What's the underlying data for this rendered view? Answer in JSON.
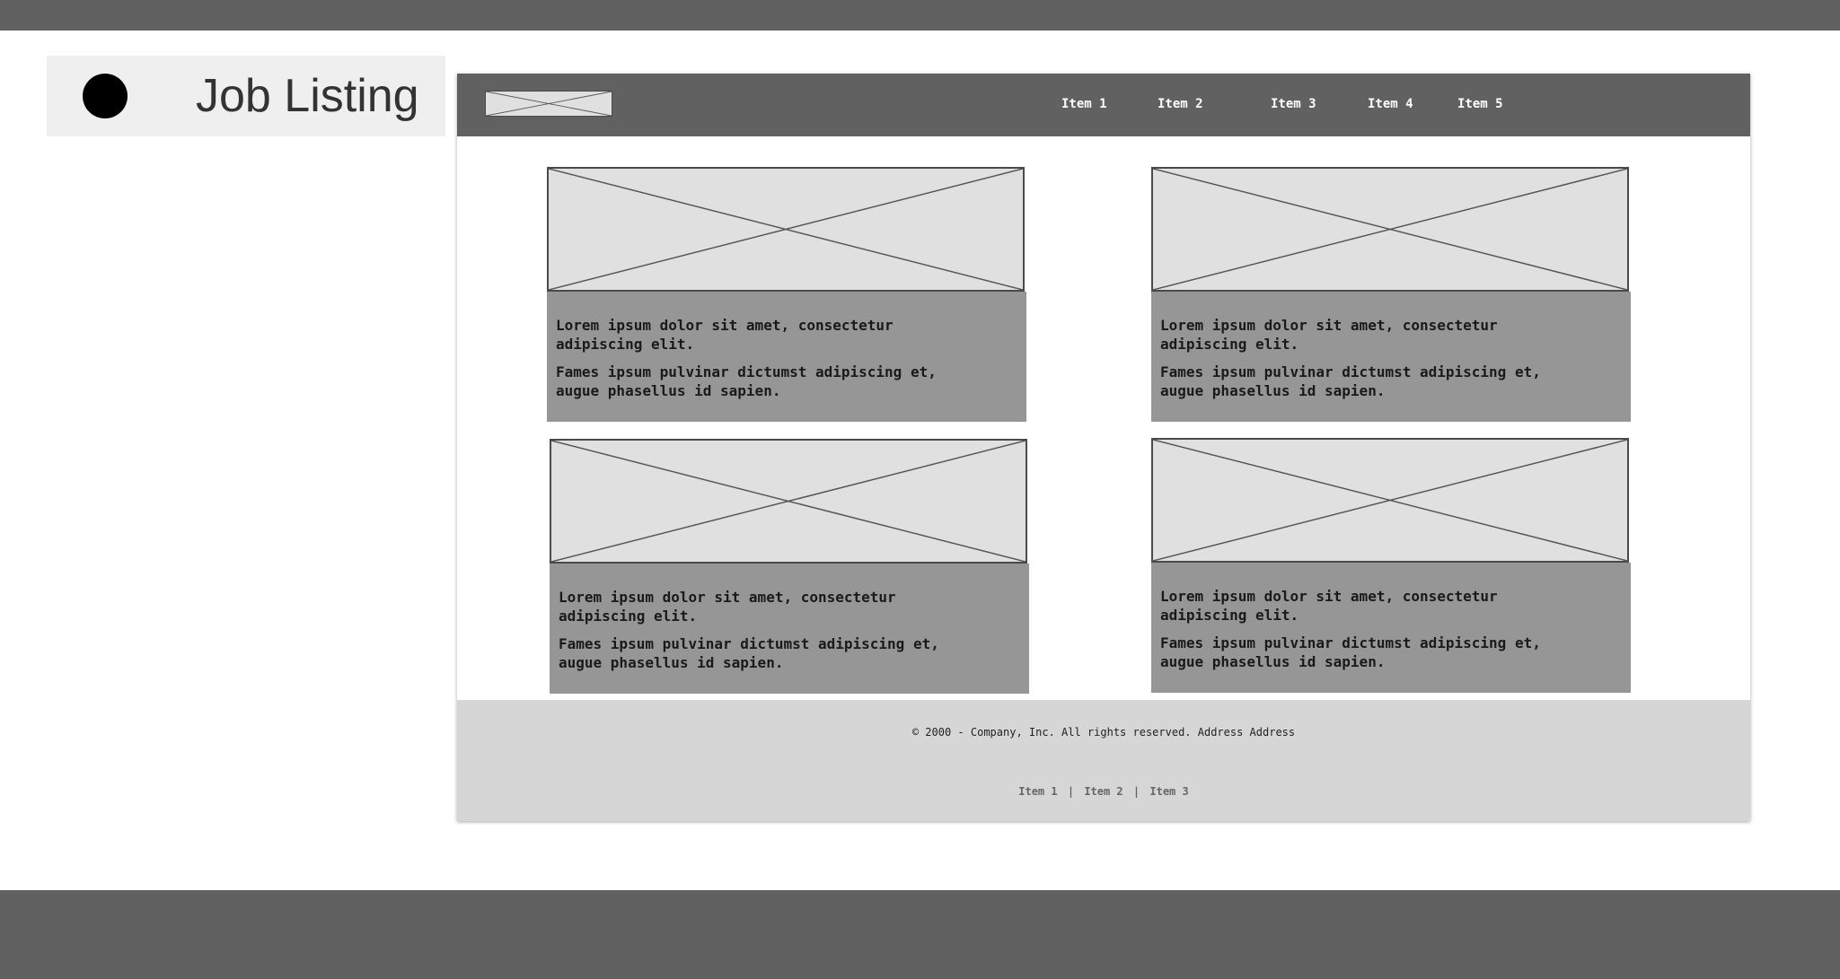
{
  "title": {
    "text": "Job Listing"
  },
  "nav": {
    "items": [
      {
        "label": "Item 1"
      },
      {
        "label": "Item 2"
      },
      {
        "label": "Item 3"
      },
      {
        "label": "Item 4"
      },
      {
        "label": "Item 5"
      }
    ]
  },
  "cards": [
    {
      "line1": "Lorem ipsum dolor sit amet, consectetur adipiscing elit.",
      "line2": "Fames ipsum pulvinar dictumst adipiscing et, augue phasellus id sapien."
    },
    {
      "line1": "Lorem ipsum dolor sit amet, consectetur adipiscing elit.",
      "line2": "Fames ipsum pulvinar dictumst adipiscing et, augue phasellus id sapien."
    },
    {
      "line1": "Lorem ipsum dolor sit amet, consectetur adipiscing elit.",
      "line2": "Fames ipsum pulvinar dictumst adipiscing et, augue phasellus id sapien."
    },
    {
      "line1": "Lorem ipsum dolor sit amet, consectetur adipiscing elit.",
      "line2": "Fames ipsum pulvinar dictumst adipiscing et, augue phasellus id sapien."
    }
  ],
  "footer": {
    "copyright": "© 2000 - Company, Inc. All rights reserved. Address Address",
    "links": [
      {
        "label": "Item 1"
      },
      {
        "label": "Item 2"
      },
      {
        "label": "Item 3"
      }
    ],
    "separator": "|"
  },
  "colors": {
    "band": "#616161",
    "navbar": "#616161",
    "card_body": "#969696",
    "placeholder_fill": "#e0e0e0",
    "footer": "#d6d6d6",
    "title_card": "#efefef"
  },
  "icons": {
    "title_marker": "filled-circle-icon",
    "image_placeholder": "crossed-box-icon"
  }
}
